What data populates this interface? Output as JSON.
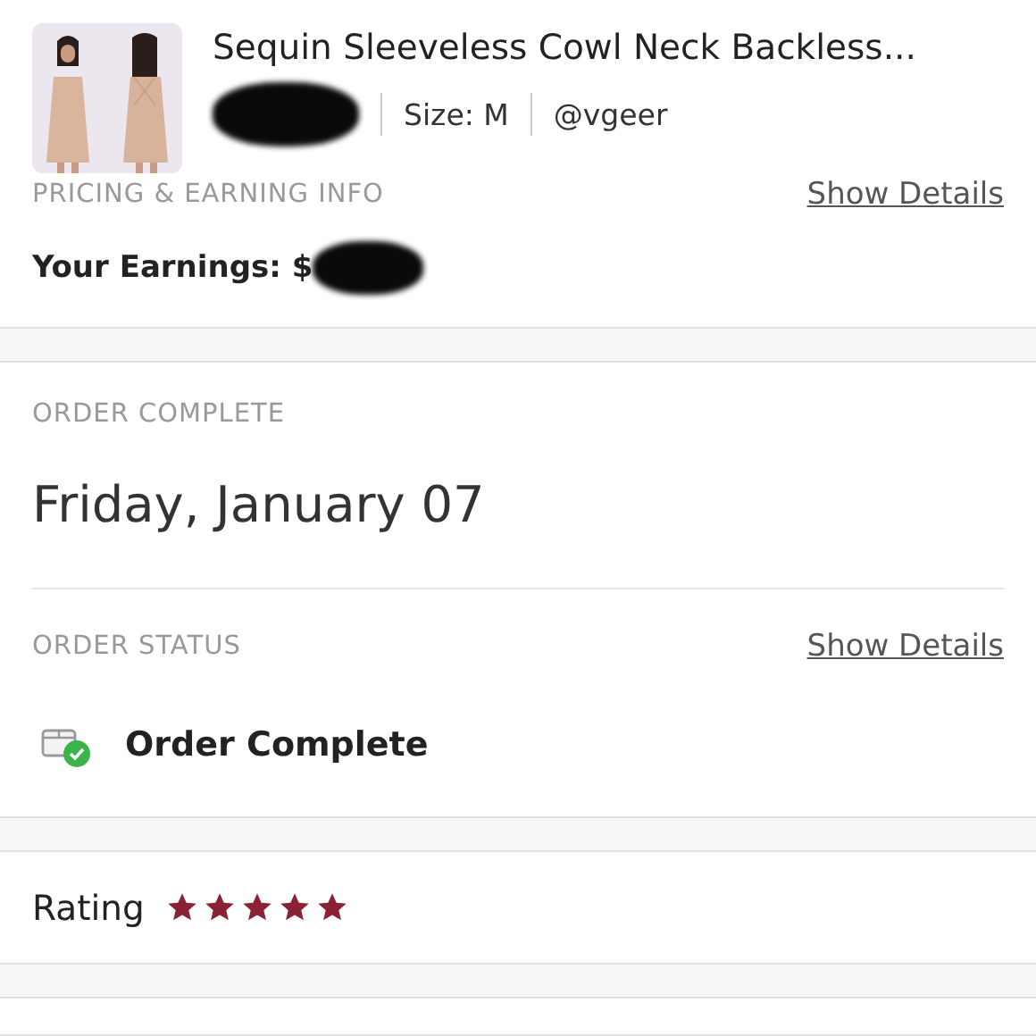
{
  "product": {
    "title": "Sequin Sleeveless Cowl Neck Backless...",
    "size": "Size: M",
    "seller": "@vgeer"
  },
  "pricing": {
    "label": "PRICING & EARNING INFO",
    "link": "Show Details",
    "earnings": "Your Earnings: $"
  },
  "order": {
    "label": "ORDER COMPLETE",
    "date": "Friday, January 07"
  },
  "status": {
    "label": "ORDER STATUS",
    "link": "Show Details",
    "value": "Order Complete"
  },
  "rating": {
    "label": "Rating",
    "stars": 5
  }
}
